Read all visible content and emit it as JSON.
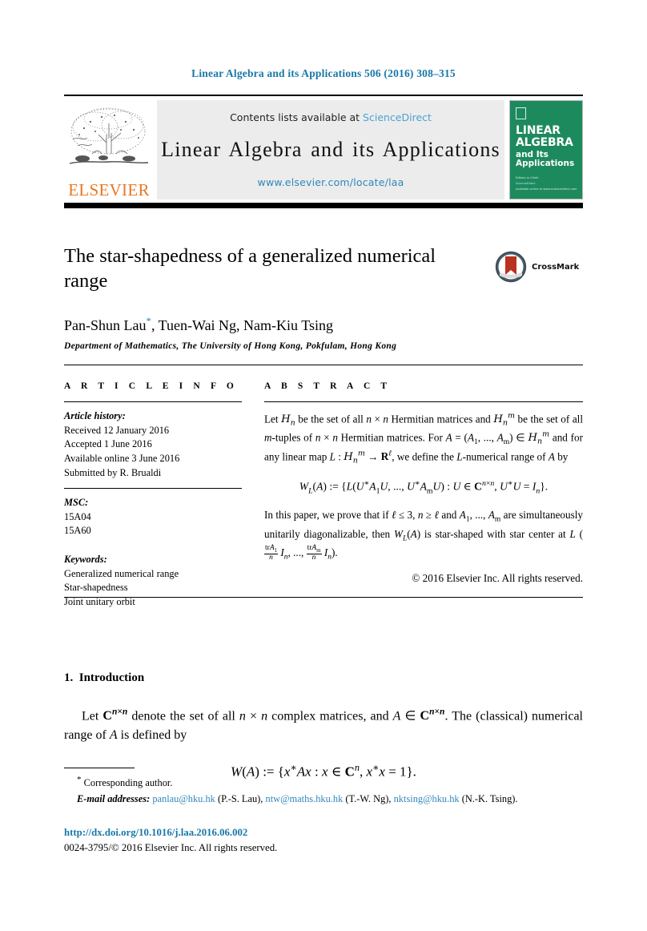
{
  "running_head": "Linear Algebra and its Applications 506 (2016) 308–315",
  "masthead": {
    "publisher_name": "ELSEVIER",
    "contents_prefix": "Contents lists available at ",
    "sciencedirect": "ScienceDirect",
    "journal_title": "Linear Algebra and its Applications",
    "journal_url": "www.elsevier.com/locate/laa",
    "cover": {
      "line1": "LINEAR",
      "line2": "ALGEBRA",
      "line3": "and Its",
      "line4": "Applications",
      "foot1": "Editors-in-Chief:",
      "foot2": "ScienceDirect",
      "foot3": "available online at www.sciencedirect.com",
      "bg_color": "#1d8a5e"
    },
    "link_color": "#2f87bb",
    "sciencedirect_color": "#4ba3d3"
  },
  "article": {
    "title": "The star-shapedness of a generalized numerical range",
    "crossmark_label": "CrossMark",
    "authors": "Pan-Shun Lau",
    "authors_rest": ", Tuen-Wai Ng, Nam-Kiu Tsing",
    "corresponding_marker": "*",
    "affiliation": "Department of Mathematics, The University of Hong Kong, Pokfulam, Hong Kong"
  },
  "info": {
    "label": "A R T I C L E   I N F O",
    "history_head": "Article history:",
    "history": [
      "Received 12 January 2016",
      "Accepted 1 June 2016",
      "Available online 3 June 2016",
      "Submitted by R. Brualdi"
    ],
    "msc_head": "MSC:",
    "msc": [
      "15A04",
      "15A60"
    ],
    "keywords_head": "Keywords:",
    "keywords": [
      "Generalized numerical range",
      "Star-shapedness",
      "Joint unitary orbit"
    ]
  },
  "abstract": {
    "label": "A B S T R A C T",
    "para1_a": "Let ",
    "para1_b": " be the set of all ",
    "para1_c": " Hermitian matrices and ",
    "para1_d": " be the set of all ",
    "para1_e": "-tuples of ",
    "para1_f": " Hermitian matrices. For ",
    "para1_g": " and for any linear map ",
    "para1_h": ", we define the ",
    "para1_i": "-numerical range of ",
    "para1_j": " by",
    "para2_a": "In this paper, we prove that if ",
    "para2_b": " and ",
    "para2_c": " are simultaneously unitarily diagonalizable, then ",
    "para2_d": " is star-shaped with star center at ",
    "copyright": "© 2016 Elsevier Inc. All rights reserved."
  },
  "body": {
    "section_number": "1.",
    "section_title": "Introduction",
    "para_a": "Let ",
    "para_b": " denote the set of all ",
    "para_c": " complex matrices, and ",
    "para_d": ". The (classical) numerical range of ",
    "para_e": " is defined by"
  },
  "footnotes": {
    "corresponding": "Corresponding author.",
    "corresponding_star": "*",
    "email_label": "E-mail addresses:",
    "emails": [
      {
        "address": "panlau@hku.hk",
        "who": "(P.-S. Lau)"
      },
      {
        "address": "ntw@maths.hku.hk",
        "who": "(T.-W. Ng)"
      },
      {
        "address": "nktsing@hku.hk",
        "who": "(N.-K. Tsing)"
      }
    ]
  },
  "colophon": {
    "doi": "http://dx.doi.org/10.1016/j.laa.2016.06.002",
    "issn_line": "0024-3795/© 2016 Elsevier Inc. All rights reserved."
  }
}
